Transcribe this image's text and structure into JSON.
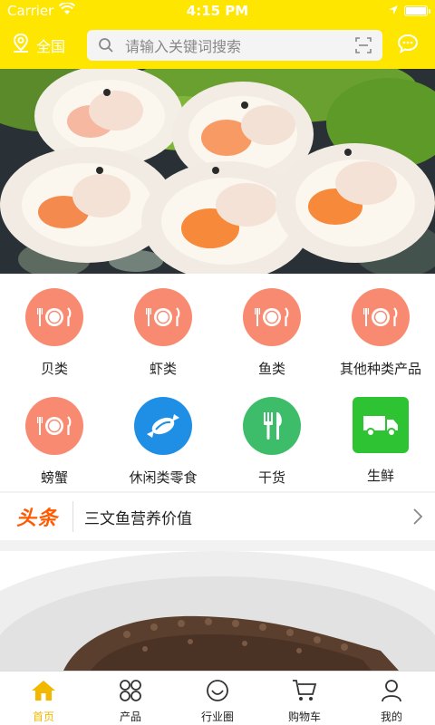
{
  "status_bar": {
    "carrier": "Carrier",
    "time": "4:15 PM",
    "battery_level": 1.0
  },
  "header": {
    "region_label": "全国",
    "search_placeholder": "请输入关键词搜索",
    "icons": [
      "location-icon",
      "search-icon",
      "scan-icon",
      "message-icon"
    ]
  },
  "banner": {
    "image": "scallops-photo"
  },
  "categories": [
    {
      "label": "贝类",
      "icon": "plate-icon",
      "color": "#f98a72"
    },
    {
      "label": "虾类",
      "icon": "plate-icon",
      "color": "#f98a72"
    },
    {
      "label": "鱼类",
      "icon": "plate-icon",
      "color": "#f98a72"
    },
    {
      "label": "其他种类产品",
      "icon": "plate-icon",
      "color": "#f98a72"
    },
    {
      "label": "螃蟹",
      "icon": "plate-icon",
      "color": "#f98a72"
    },
    {
      "label": "休闲类零食",
      "icon": "candy-icon",
      "color": "#1f8fe6"
    },
    {
      "label": "干货",
      "icon": "fork-knife-icon",
      "color": "#3dbd6a"
    },
    {
      "label": "生鲜",
      "icon": "truck-icon",
      "color": "#2ec332"
    }
  ],
  "headline": {
    "logo": "头条",
    "text": "三文鱼营养价值"
  },
  "tabs": [
    {
      "label": "首页",
      "icon": "home-icon",
      "active": true
    },
    {
      "label": "产品",
      "icon": "grid-icon",
      "active": false
    },
    {
      "label": "行业圈",
      "icon": "smile-icon",
      "active": false
    },
    {
      "label": "购物车",
      "icon": "cart-icon",
      "active": false
    },
    {
      "label": "我的",
      "icon": "user-icon",
      "active": false
    }
  ],
  "colors": {
    "brand_yellow": "#ffe600",
    "active_tab": "#f2b800",
    "headline_orange": "#ff5a00"
  }
}
